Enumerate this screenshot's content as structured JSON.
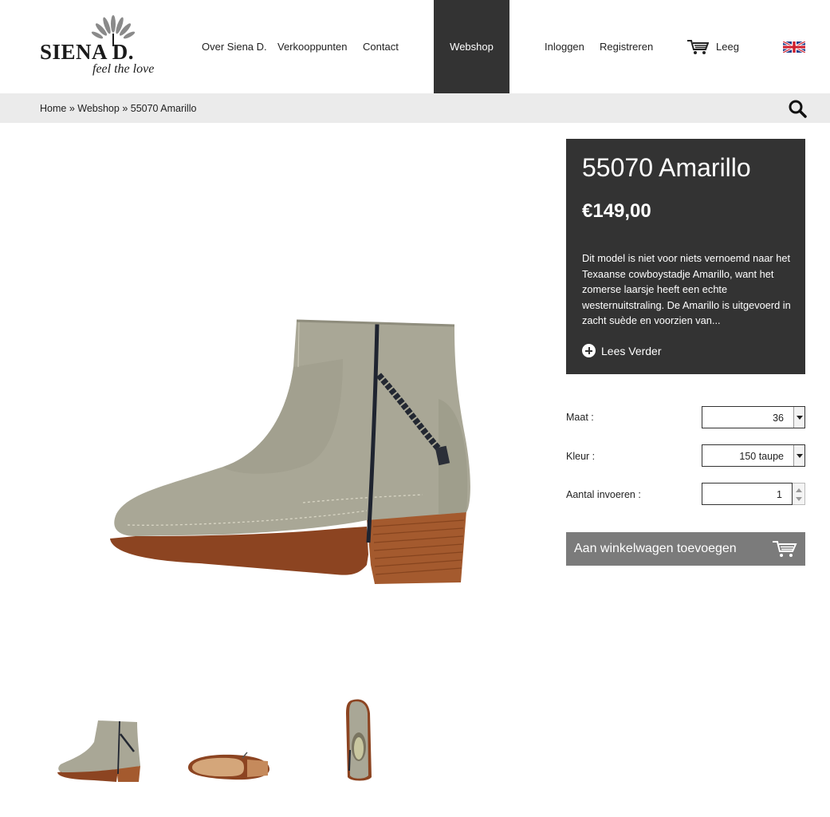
{
  "brand": {
    "logo_text": "SIENA D.",
    "tagline": "feel the love"
  },
  "nav": {
    "items": [
      "Over Siena D.",
      "Verkooppunten",
      "Contact"
    ],
    "webshop": "Webshop",
    "login": "Inloggen",
    "register": "Registreren",
    "cart_status": "Leeg",
    "cart_icon": "shopping-cart-icon",
    "language_icon": "uk-flag-icon"
  },
  "breadcrumb": {
    "home": "Home",
    "sep1": " » ",
    "webshop": "Webshop",
    "sep2": " » ",
    "current": "55070 Amarillo"
  },
  "product": {
    "title": "55070 Amarillo",
    "price": "€149,00",
    "description": "Dit model is niet voor niets vernoemd naar het Texaanse cowboystadje Amarillo, want het zomerse laarsje heeft een echte westernuitstraling. De Amarillo is uitgevoerd in zacht suède en voorzien van...",
    "read_more": "Lees Verder",
    "size_label": "Maat :",
    "size_value": "36",
    "color_label": "Kleur :",
    "color_value": "150 taupe",
    "qty_label": "Aantal invoeren :",
    "qty_value": "1",
    "add_to_cart": "Aan winkelwagen toevoegen"
  },
  "colors": {
    "dark_panel": "#333333",
    "breadcrumb_bg": "#ebebeb",
    "button_bg": "#7b7b7b",
    "boot_suede": "#a9a796",
    "boot_sole": "#9a4e26"
  }
}
